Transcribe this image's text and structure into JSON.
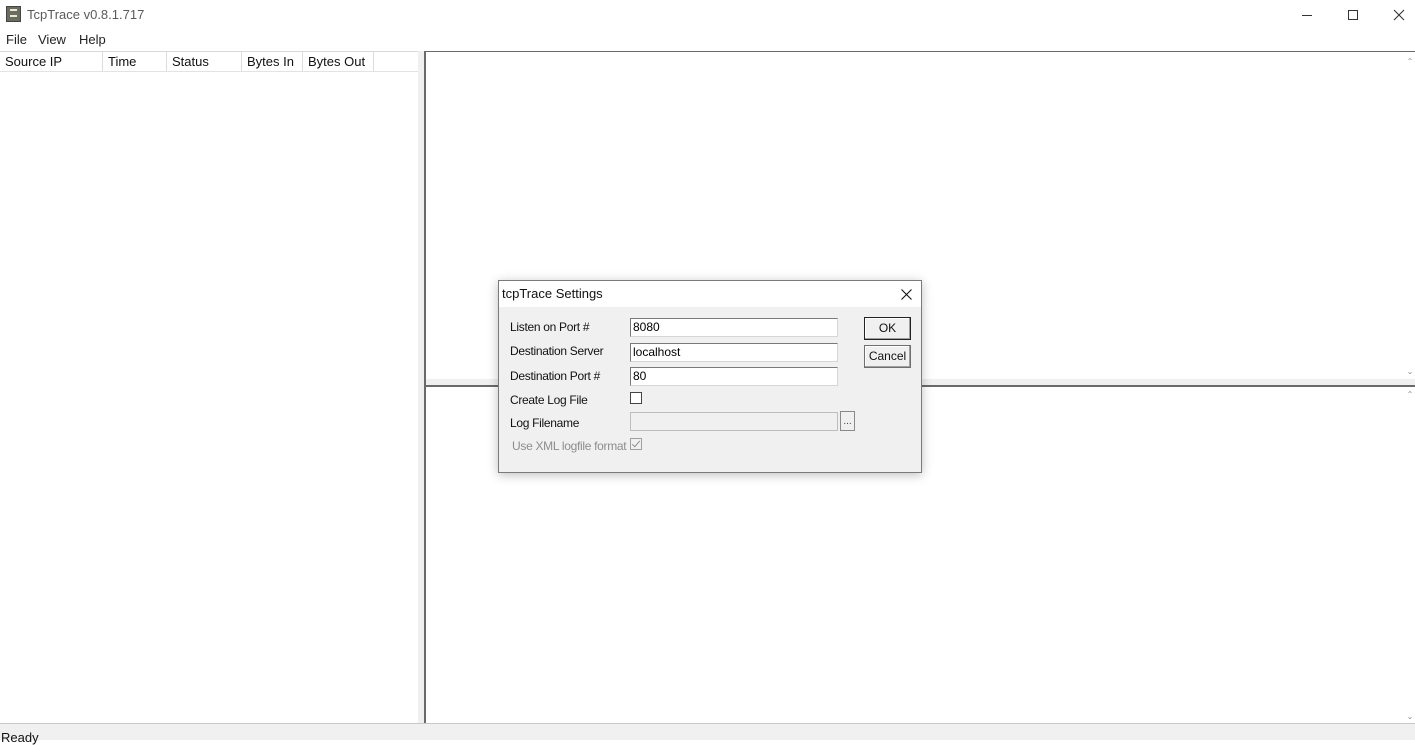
{
  "window": {
    "title": "TcpTrace v0.8.1.717"
  },
  "menu": {
    "file": "File",
    "view": "View",
    "help": "Help"
  },
  "list": {
    "columns": [
      {
        "label": "Source IP"
      },
      {
        "label": "Time"
      },
      {
        "label": "Status"
      },
      {
        "label": "Bytes In"
      },
      {
        "label": "Bytes Out"
      }
    ]
  },
  "status": {
    "text": "Ready"
  },
  "dialog": {
    "title": "tcpTrace Settings",
    "listen_port_label": "Listen on Port #",
    "listen_port_value": "8080",
    "dest_server_label": "Destination Server",
    "dest_server_value": "localhost",
    "dest_port_label": "Destination Port #",
    "dest_port_value": "80",
    "create_log_label": "Create Log File",
    "create_log_checked": false,
    "log_filename_label": "Log Filename",
    "log_filename_value": "",
    "browse_label": "...",
    "xml_format_label": "Use XML logfile format",
    "xml_format_checked": true,
    "ok_label": "OK",
    "cancel_label": "Cancel"
  }
}
